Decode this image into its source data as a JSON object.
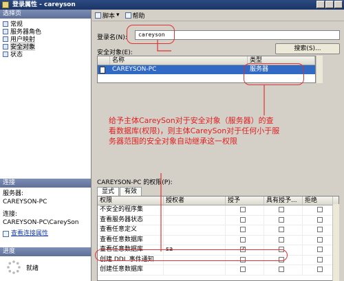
{
  "window": {
    "title": "登录属性 - careyson"
  },
  "left": {
    "select_header": "选择页",
    "nav_items": [
      {
        "label": "常规"
      },
      {
        "label": "服务器角色"
      },
      {
        "label": "用户映射"
      },
      {
        "label": "安全对象"
      },
      {
        "label": "状态"
      }
    ],
    "conn_header": "连接",
    "server_label": "服务器:",
    "server_value": "CAREYSON-PC",
    "conn_label": "连接:",
    "conn_value": "CAREYSON-PC\\CareySon",
    "view_conn_link": "查看连接属性",
    "progress_header": "进度",
    "progress_status": "就绪"
  },
  "toolbar": {
    "script_label": "脚本",
    "help_label": "帮助"
  },
  "login": {
    "label": "登录名(N):",
    "value": "careyson"
  },
  "securables": {
    "label": "安全对象(E):",
    "search_button": "搜索(S)...",
    "columns": [
      "名称",
      "类型"
    ],
    "rows": [
      {
        "name": "CAREYSON-PC",
        "type": "服务器"
      }
    ]
  },
  "annotation": "给予主体CareySon对于安全对象（服务器）的查看数据库(权限)，则主体CareySon对于任何小于服务器范围的安全对象自动继承这一权限",
  "permissions": {
    "label": "CAREYSON-PC 的权限(P):",
    "tabs": [
      "显式",
      "有效"
    ],
    "columns": [
      "权限",
      "授权者",
      "授予",
      "具有授予...",
      "拒绝"
    ],
    "rows": [
      {
        "name": "不安全的程序集",
        "grantor": "",
        "grant": false,
        "with_grant": false,
        "deny": false
      },
      {
        "name": "查看服务器状态",
        "grantor": "",
        "grant": false,
        "with_grant": false,
        "deny": false
      },
      {
        "name": "查看任意定义",
        "grantor": "",
        "grant": false,
        "with_grant": false,
        "deny": false
      },
      {
        "name": "查看任意数据库",
        "grantor": "",
        "grant": false,
        "with_grant": false,
        "deny": false
      },
      {
        "name": "查看任意数据库",
        "grantor": "sa",
        "grant": true,
        "with_grant": false,
        "deny": false
      },
      {
        "name": "创建 DDL 事件通知",
        "grantor": "",
        "grant": false,
        "with_grant": false,
        "deny": false
      },
      {
        "name": "创建任意数据库",
        "grantor": "",
        "grant": false,
        "with_grant": false,
        "deny": false
      }
    ]
  }
}
